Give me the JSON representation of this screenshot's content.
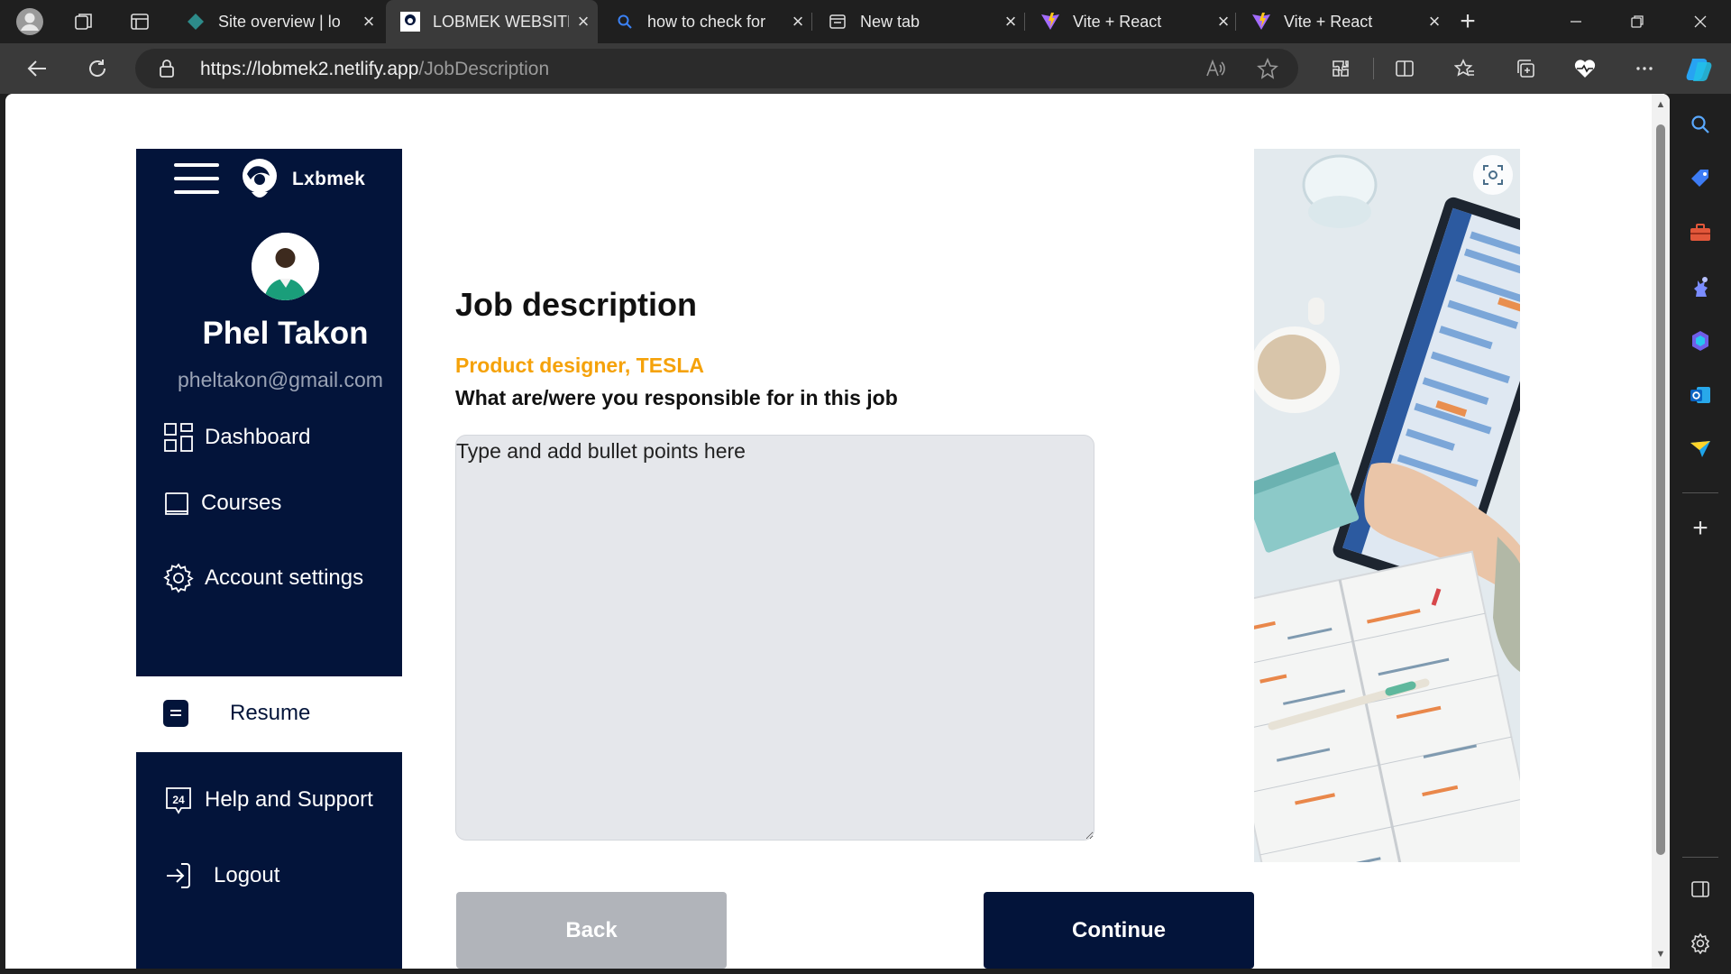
{
  "browser": {
    "tabs": [
      {
        "title": "Site overview | lo",
        "active": false
      },
      {
        "title": "LOBMEK WEBSITE",
        "active": true
      },
      {
        "title": "how to check for",
        "active": false
      },
      {
        "title": "New tab",
        "active": false
      },
      {
        "title": "Vite + React",
        "active": false
      },
      {
        "title": "Vite + React",
        "active": false
      }
    ],
    "url_domain": "https://lobmek2.netlify.app",
    "url_path": "/JobDescription"
  },
  "sidebar": {
    "logo_text": "Lxbmek",
    "user_name": "Phel Takon",
    "user_email": "pheltakon@gmail.com",
    "items": [
      {
        "label": "Dashboard",
        "icon": "dashboard-icon"
      },
      {
        "label": "Courses",
        "icon": "courses-icon"
      },
      {
        "label": "Account settings",
        "icon": "settings-icon"
      },
      {
        "label": "Resume",
        "icon": "resume-icon",
        "active": true
      },
      {
        "label": "Help and Support",
        "icon": "support-24-icon"
      },
      {
        "label": "Logout",
        "icon": "logout-icon"
      }
    ]
  },
  "main": {
    "title": "Job description",
    "role": "Product designer, TESLA",
    "question": "What are/were you responsible for in this job",
    "textarea_placeholder": "Type and add bullet points here",
    "back_label": "Back",
    "continue_label": "Continue"
  },
  "colors": {
    "navy": "#03143a",
    "accent_orange": "#f5a20a",
    "back_gray": "#b1b4ba",
    "textarea_bg": "#e5e7eb"
  }
}
